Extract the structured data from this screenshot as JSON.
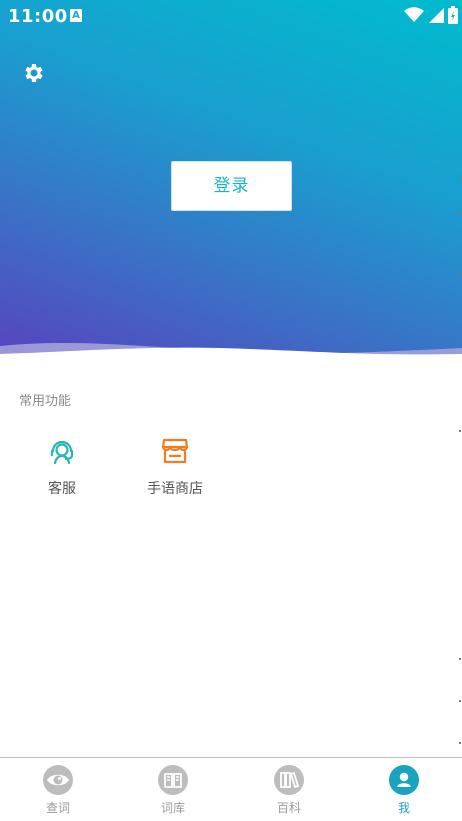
{
  "status_bar": {
    "time": "11:00",
    "notification_icon": "A"
  },
  "header": {
    "settings_icon": "gear-icon",
    "login_label": "登录"
  },
  "common_functions": {
    "title": "常用功能",
    "items": [
      {
        "label": "客服",
        "icon": "customer-service-icon",
        "color": "#26b6b4"
      },
      {
        "label": "手语商店",
        "icon": "store-icon",
        "color": "#f07d23"
      }
    ]
  },
  "tabs": [
    {
      "label": "查词",
      "icon": "eye-icon",
      "active": false
    },
    {
      "label": "词库",
      "icon": "book-icon",
      "active": false
    },
    {
      "label": "百科",
      "icon": "encyclopedia-icon",
      "active": false
    },
    {
      "label": "我",
      "icon": "person-icon",
      "active": true
    }
  ],
  "colors": {
    "accent": "#1aa3c1",
    "gradient_top": "#00bccd",
    "gradient_bottom": "#5a3fbf",
    "inactive": "#bdbdbd"
  }
}
